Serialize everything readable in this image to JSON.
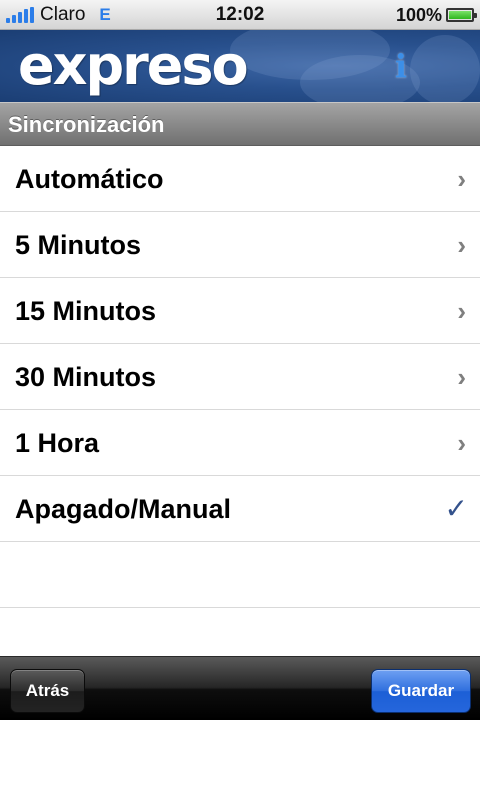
{
  "status_bar": {
    "carrier": "Claro",
    "network_type": "E",
    "time": "12:02",
    "battery_percent": "100%"
  },
  "header": {
    "logo_text": "expreso",
    "info_icon_glyph": "i"
  },
  "section": {
    "title": "Sincronización"
  },
  "options": [
    {
      "label": "Automático",
      "selected": false,
      "glyph": "›"
    },
    {
      "label": "5 Minutos",
      "selected": false,
      "glyph": "›"
    },
    {
      "label": "15 Minutos",
      "selected": false,
      "glyph": "›"
    },
    {
      "label": "30 Minutos",
      "selected": false,
      "glyph": "›"
    },
    {
      "label": "1 Hora",
      "selected": false,
      "glyph": "›"
    },
    {
      "label": "Apagado/Manual",
      "selected": true,
      "glyph": "✓"
    }
  ],
  "toolbar": {
    "back_label": "Atrás",
    "save_label": "Guardar"
  },
  "colors": {
    "accent_blue": "#2566dc",
    "checkmark": "#34528c",
    "banner": "#28508d"
  }
}
